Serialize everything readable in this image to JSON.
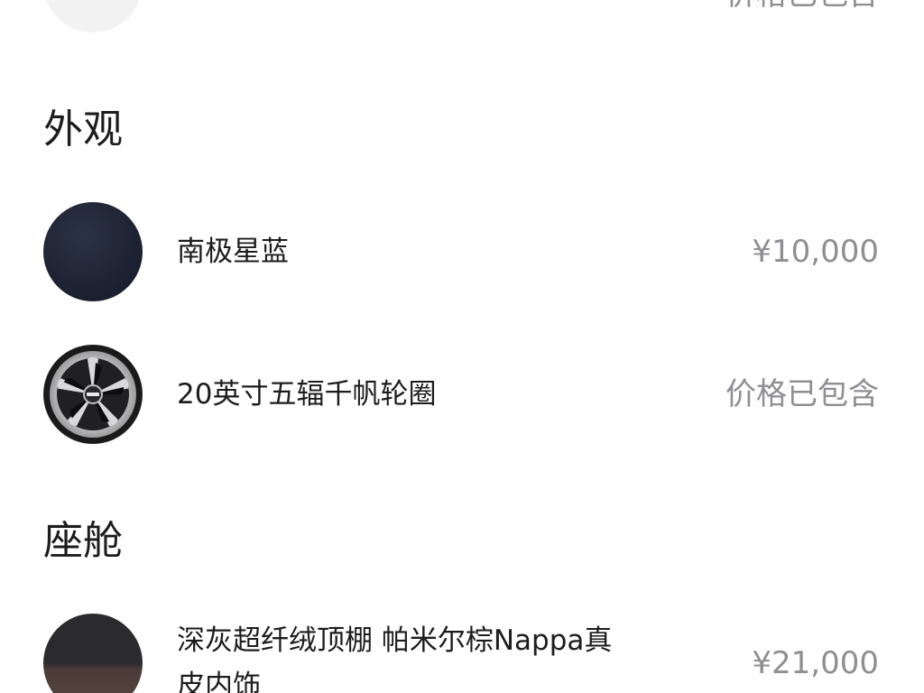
{
  "top_item": {
    "label": "",
    "price": "价格已包含"
  },
  "sections": [
    {
      "title": "外观",
      "items": [
        {
          "label": "南极星蓝",
          "price": "¥10,000",
          "thumb": "paint-swatch-dark-blue"
        },
        {
          "label": "20英寸五辐千帆轮圈",
          "price": "价格已包含",
          "thumb": "wheel-rim"
        }
      ]
    },
    {
      "title": "座舱",
      "items": [
        {
          "label_line1": "深灰超纤绒顶棚 帕米尔棕Nappa真",
          "label_line2": "皮内饰",
          "price": "¥21,000",
          "thumb": "interior-swatch"
        }
      ]
    }
  ],
  "colors": {
    "text": "#1c1c1e",
    "secondary": "#8e8e93",
    "paint_blue": "#1e2434"
  }
}
